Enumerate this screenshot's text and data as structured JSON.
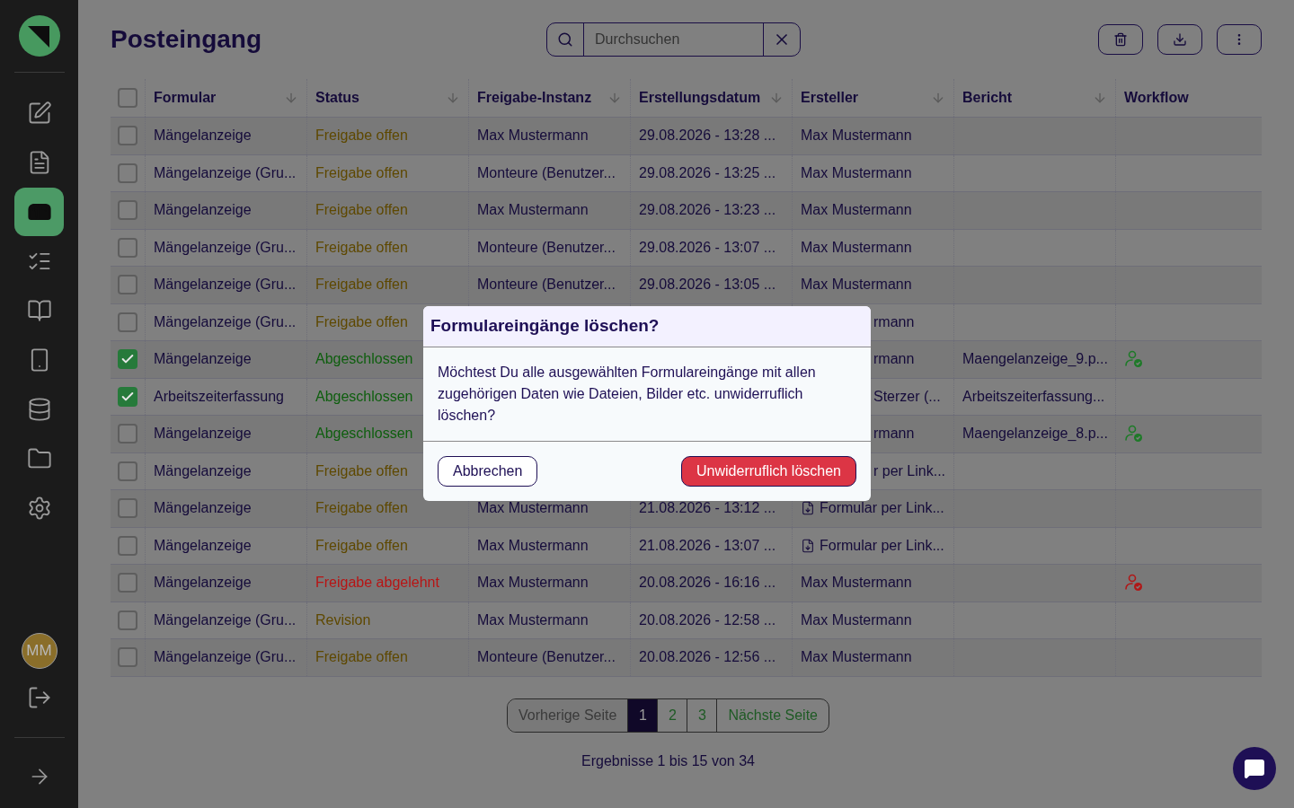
{
  "sidebar": {
    "items": [
      {
        "selected": false
      },
      {
        "selected": false
      },
      {
        "selected": true
      },
      {
        "selected": false
      },
      {
        "selected": false
      },
      {
        "selected": false
      },
      {
        "selected": false
      },
      {
        "selected": false
      },
      {
        "selected": false
      }
    ],
    "avatar": "MM"
  },
  "header": {
    "title": "Posteingang",
    "search": {
      "placeholder": "Durchsuchen"
    }
  },
  "table": {
    "all_checked": false,
    "columns": [
      {
        "label": "Formular",
        "sortable": true
      },
      {
        "label": "Status",
        "sortable": true
      },
      {
        "label": "Freigabe-Instanz",
        "sortable": true
      },
      {
        "label": "Erstellungsdatum",
        "sortable": true
      },
      {
        "label": "Ersteller",
        "sortable": true
      },
      {
        "label": "Bericht",
        "sortable": true
      },
      {
        "label": "Workflow",
        "sortable": false
      }
    ],
    "rows": [
      {
        "checked": false,
        "formular": "Mängelanzeige",
        "status": {
          "label": "Freigabe offen",
          "color": "#5e4800"
        },
        "instanz": "Max Mustermann",
        "datum": "29.08.2026 - 13:28 ...",
        "ersteller": "Max Mustermann"
      },
      {
        "checked": false,
        "formular": "Mängelanzeige (Gru...",
        "status": {
          "label": "Freigabe offen",
          "color": "#5e4800"
        },
        "instanz": "Monteure (Benutzer...",
        "datum": "29.08.2026 - 13:25 ...",
        "ersteller": "Max Mustermann"
      },
      {
        "checked": false,
        "formular": "Mängelanzeige",
        "status": {
          "label": "Freigabe offen",
          "color": "#5e4800"
        },
        "instanz": "Max Mustermann",
        "datum": "29.08.2026 - 13:23 ...",
        "ersteller": "Max Mustermann"
      },
      {
        "checked": false,
        "formular": "Mängelanzeige (Gru...",
        "status": {
          "label": "Freigabe offen",
          "color": "#5e4800"
        },
        "instanz": "Monteure (Benutzer...",
        "datum": "29.08.2026 - 13:07 ...",
        "ersteller": "Max Mustermann"
      },
      {
        "checked": false,
        "formular": "Mängelanzeige (Gru...",
        "status": {
          "label": "Freigabe offen",
          "color": "#5e4800"
        },
        "instanz": "Monteure (Benutzer...",
        "datum": "29.08.2026 - 13:05 ...",
        "ersteller": "Max Mustermann"
      },
      {
        "checked": false,
        "formular": "Mängelanzeige (Gru...",
        "status": {
          "label": "Freigabe offen",
          "color": "#5e4800"
        },
        "ersteller": "rmann"
      },
      {
        "checked": true,
        "formular": "Mängelanzeige",
        "status": {
          "label": "Abgeschlossen",
          "color": "#0d5e0d"
        },
        "ersteller": "rmann",
        "bericht": "Maengelanzeige_9.p...",
        "workflow": {
          "color": "#1e7a28"
        }
      },
      {
        "checked": true,
        "formular": "Arbeitszeiterfassung",
        "status": {
          "label": "Abgeschlossen",
          "color": "#0d5e0d"
        },
        "ersteller": "Sterzer (...",
        "bericht": "Arbeitszeiterfassung..."
      },
      {
        "checked": false,
        "formular": "Mängelanzeige",
        "status": {
          "label": "Abgeschlossen",
          "color": "#0d5e0d"
        },
        "ersteller": "rmann",
        "bericht": "Maengelanzeige_8.p...",
        "workflow": {
          "color": "#1e7a28"
        }
      },
      {
        "checked": false,
        "formular": "Mängelanzeige",
        "status": {
          "label": "Freigabe offen",
          "color": "#5e4800"
        },
        "ersteller": "r per Link..."
      },
      {
        "checked": false,
        "formular": "Mängelanzeige",
        "status": {
          "label": "Freigabe offen",
          "color": "#5e4800"
        },
        "instanz": "Max Mustermann",
        "datum": "21.08.2026 - 13:12 ...",
        "ersteller": "Formular per Link...",
        "via_link": true
      },
      {
        "checked": false,
        "formular": "Mängelanzeige",
        "status": {
          "label": "Freigabe offen",
          "color": "#5e4800"
        },
        "instanz": "Max Mustermann",
        "datum": "21.08.2026 - 13:07 ...",
        "ersteller": "Formular per Link...",
        "via_link": true
      },
      {
        "checked": false,
        "formular": "Mängelanzeige",
        "status": {
          "label": "Freigabe abgelehnt",
          "color": "#b81414"
        },
        "instanz": "Max Mustermann",
        "datum": "20.08.2026 - 16:16 ...",
        "ersteller": "Max Mustermann",
        "workflow": {
          "color": "#b01818"
        }
      },
      {
        "checked": false,
        "formular": "Mängelanzeige (Gru...",
        "status": {
          "label": "Revision",
          "color": "#5e4800"
        },
        "instanz": "Max Mustermann",
        "datum": "20.08.2026 - 12:58 ...",
        "ersteller": "Max Mustermann"
      },
      {
        "checked": false,
        "formular": "Mängelanzeige (Gru...",
        "status": {
          "label": "Freigabe offen",
          "color": "#5e4800"
        },
        "instanz": "Monteure (Benutzer...",
        "datum": "20.08.2026 - 12:56 ...",
        "ersteller": "Max Mustermann"
      }
    ]
  },
  "pagination": {
    "previous": {
      "label": "Vorherige Seite",
      "disabled": true
    },
    "pages": [
      {
        "label": "1",
        "selected": true
      },
      {
        "label": "2",
        "selected": false
      },
      {
        "label": "3",
        "selected": false
      }
    ],
    "next": {
      "label": "Nächste Seite",
      "disabled": false
    },
    "summary": "Ergebnisse 1 bis 15 von 34"
  },
  "dialog": {
    "title": "Formulareingänge löschen?",
    "message": "Möchtest Du alle ausgewählten Formulareingänge mit allen zugehörigen Daten wie Dateien, Bilder etc. unwiderruflich löschen?",
    "cancel": "Abbrechen",
    "confirm": "Unwiderruflich löschen"
  }
}
